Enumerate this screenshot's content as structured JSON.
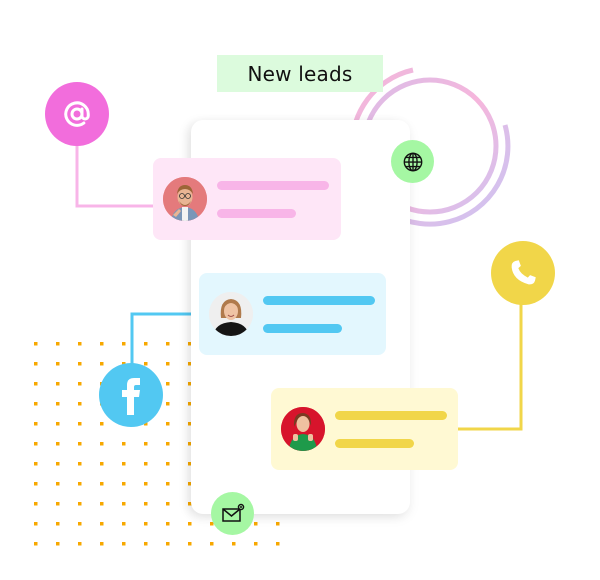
{
  "header": {
    "title": "New leads"
  },
  "channels": [
    {
      "name": "email-at",
      "icon": "at-sign-icon",
      "color": "#f26ddc"
    },
    {
      "name": "facebook",
      "icon": "facebook-icon",
      "color": "#52c8f2"
    },
    {
      "name": "phone",
      "icon": "phone-icon",
      "color": "#f1d649"
    },
    {
      "name": "website",
      "icon": "globe-icon",
      "color": "#a5f7a3"
    },
    {
      "name": "mail",
      "icon": "mail-notification-icon",
      "color": "#a5f7a3"
    }
  ],
  "leads": [
    {
      "source": "email",
      "avatar": "man-with-glasses-avatar",
      "card_color": "#fee6f7",
      "line_color": "#f8b5e8"
    },
    {
      "source": "facebook",
      "avatar": "woman-blonde-avatar",
      "card_color": "#e3f7fe",
      "line_color": "#52c8f2"
    },
    {
      "source": "phone",
      "avatar": "woman-green-sweater-avatar",
      "card_color": "#fff9d3",
      "line_color": "#f1d649"
    }
  ],
  "colors": {
    "badge_bg": "#dcfbdd",
    "dots": "#f7a800",
    "ring_pink": "#f8b5d8",
    "ring_purple": "#d0c3f0"
  }
}
